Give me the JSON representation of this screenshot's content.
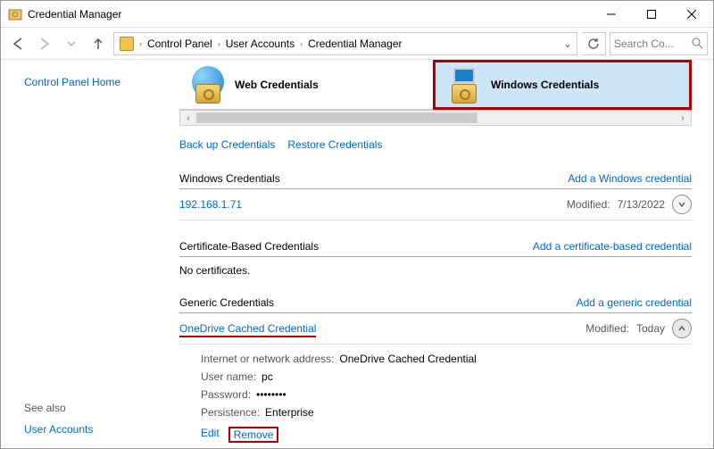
{
  "window": {
    "title": "Credential Manager"
  },
  "breadcrumb": {
    "p1": "Control Panel",
    "p2": "User Accounts",
    "p3": "Credential Manager"
  },
  "search": {
    "placeholder": "Search Co..."
  },
  "sidebar": {
    "home": "Control Panel Home",
    "seealso": "See also",
    "useraccounts": "User Accounts"
  },
  "tabs": {
    "web": "Web Credentials",
    "win": "Windows Credentials"
  },
  "actions": {
    "backup": "Back up Credentials",
    "restore": "Restore Credentials"
  },
  "sections": {
    "win": {
      "title": "Windows Credentials",
      "addlink": "Add a Windows credential",
      "item": {
        "name": "192.168.1.71",
        "modlabel": "Modified:",
        "modval": "7/13/2022"
      }
    },
    "cert": {
      "title": "Certificate-Based Credentials",
      "addlink": "Add a certificate-based credential",
      "empty": "No certificates."
    },
    "gen": {
      "title": "Generic Credentials",
      "addlink": "Add a generic credential",
      "item": {
        "name": "OneDrive Cached Credential",
        "modlabel": "Modified:",
        "modval": "Today",
        "addr_k": "Internet or network address:",
        "addr_v": "OneDrive Cached Credential",
        "user_k": "User name:",
        "user_v": "pc",
        "pass_k": "Password:",
        "pass_v": "••••••••",
        "pers_k": "Persistence:",
        "pers_v": "Enterprise",
        "edit": "Edit",
        "remove": "Remove"
      }
    }
  }
}
